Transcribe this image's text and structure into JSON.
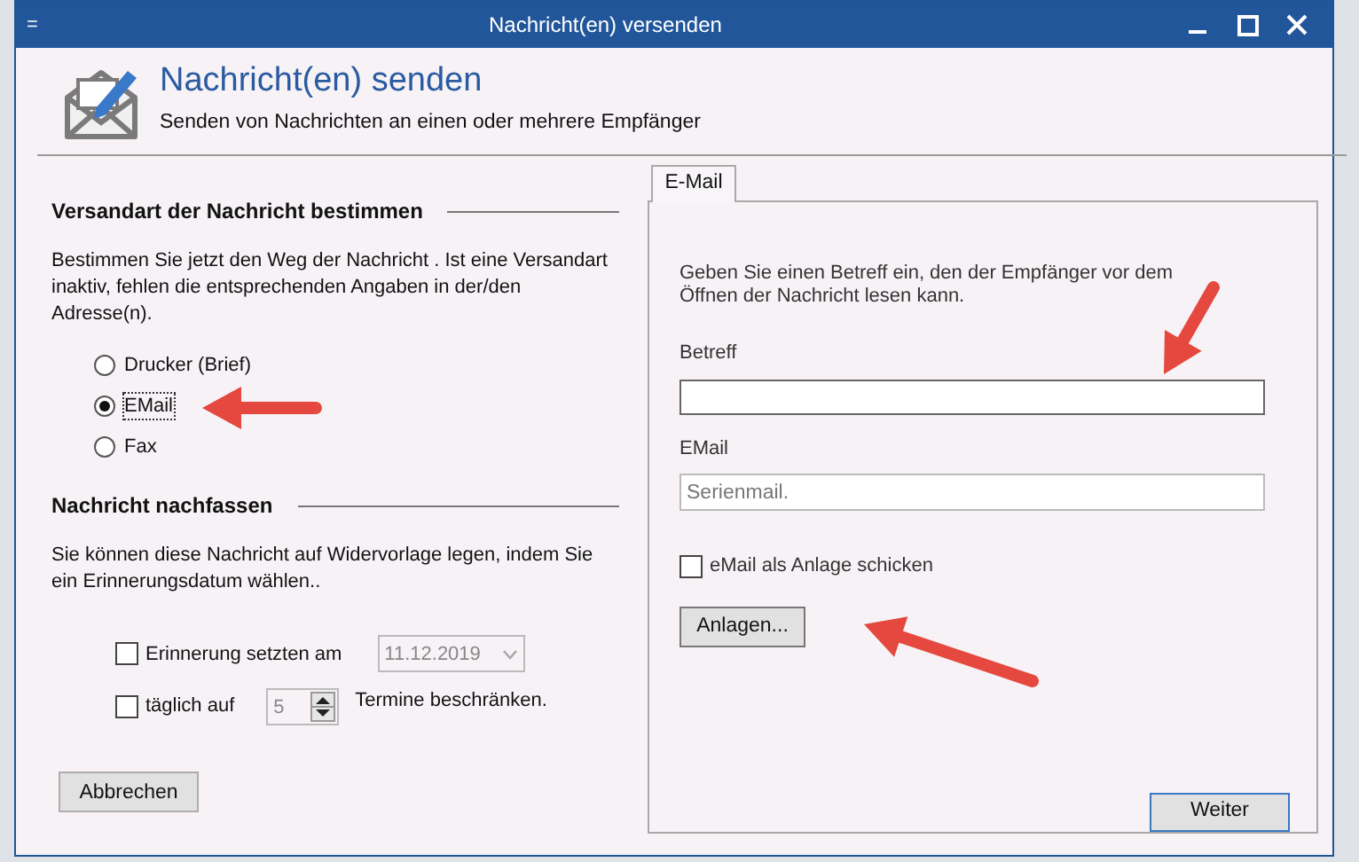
{
  "window": {
    "title": "Nachricht(en) versenden",
    "menu_glyph": "="
  },
  "header": {
    "title": "Nachricht(en) senden",
    "subtitle": "Senden von Nachrichten an einen oder mehrere Empfänger"
  },
  "delivery": {
    "heading": "Versandart der Nachricht bestimmen",
    "description": "Bestimmen Sie jetzt den Weg der Nachricht . Ist eine Versandart inaktiv, fehlen die entsprechenden Angaben in der/den Adresse(n).",
    "options": [
      {
        "label": "Drucker (Brief)",
        "selected": false
      },
      {
        "label": "EMail",
        "selected": true
      },
      {
        "label": "Fax",
        "selected": false
      }
    ]
  },
  "follow_up": {
    "heading": "Nachricht nachfassen",
    "description": "Sie können diese Nachricht auf Widervorlage legen, indem Sie ein Erinnerungsdatum wählen..",
    "reminder": {
      "label": "Erinnerung setzten am",
      "checked": false,
      "date": "11.12.2019",
      "disabled": true
    },
    "daily_limit": {
      "label": "täglich auf",
      "checked": false,
      "value": "5",
      "disabled": true,
      "suffix": "Termine beschränken."
    }
  },
  "cancel_button": "Abbrechen",
  "tabs": [
    {
      "label": "E-Mail",
      "selected": true
    }
  ],
  "email": {
    "description": "Geben Sie einen Betreff ein, den der Empfänger vor dem Öffnen der Nachricht lesen kann.",
    "subject_label": "Betreff",
    "email_label": "EMail",
    "email_placeholder": "Serienmail.",
    "attach_checkbox": {
      "label": "eMail als Anlage schicken",
      "checked": false
    },
    "attachments_button": "Anlagen..."
  },
  "next_button": "Weiter"
}
